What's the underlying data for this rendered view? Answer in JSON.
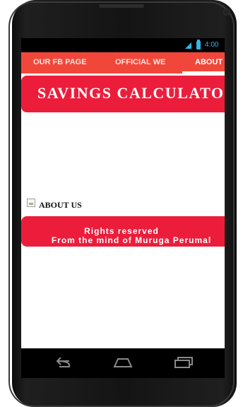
{
  "status_bar": {
    "time": "4:00",
    "icons": [
      "signal-icon",
      "battery-icon"
    ]
  },
  "tabs": [
    {
      "label": "OUR FB PAGE",
      "active": false
    },
    {
      "label": "OFFICIAL WE",
      "active": false
    },
    {
      "label": "ABOUT",
      "active": true
    }
  ],
  "header": {
    "title": "SAVINGS CALCULATO"
  },
  "about": {
    "label": "ABOUT US",
    "icon": "broken-image-icon"
  },
  "footer": {
    "line1": "Rights reserved",
    "line2": "From the mind of Muruga Perumal"
  },
  "nav_bar": {
    "icons": [
      "back-icon",
      "home-icon",
      "recent-apps-icon"
    ]
  },
  "colors": {
    "tab_bar": "#f1473a",
    "banner": "#ec1d3b",
    "status_accent": "#33b5e5"
  }
}
